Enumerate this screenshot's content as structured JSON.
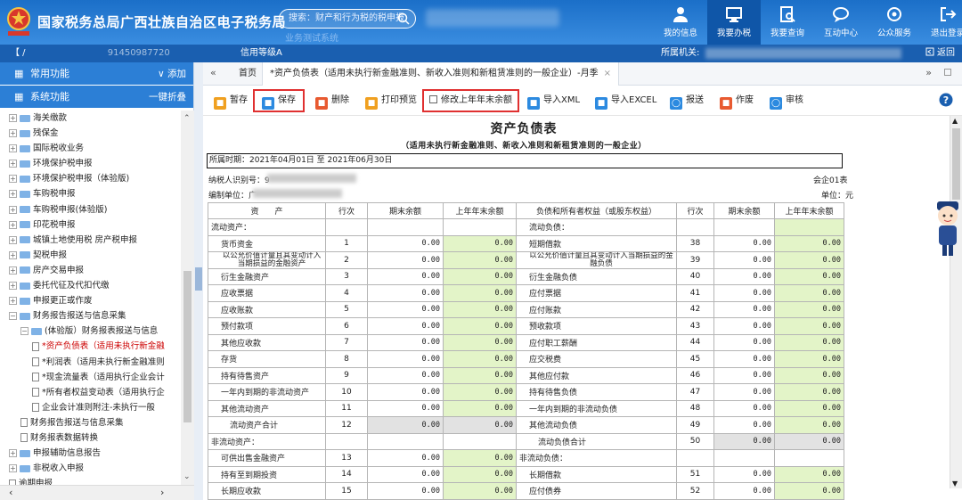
{
  "header": {
    "title": "国家税务总局广西壮族自治区电子税务局",
    "search_placeholder": "搜索：财产和行为税的税申报",
    "banner_sub": "业务测试系统",
    "nav": [
      {
        "label": "我的信息",
        "icon": "user-icon"
      },
      {
        "label": "我要办税",
        "icon": "monitor-icon",
        "active": true
      },
      {
        "label": "我要查询",
        "icon": "query-icon"
      },
      {
        "label": "互动中心",
        "icon": "chat-icon"
      },
      {
        "label": "公众服务",
        "icon": "service-icon"
      },
      {
        "label": "退出登录",
        "icon": "logout-icon"
      }
    ]
  },
  "infobar": {
    "user": "【 / ",
    "user_code": "91450987720",
    "credit": "信用等级A",
    "authority_label": "所属机关:",
    "return_label": "返回"
  },
  "sidebar": {
    "common_label": "常用功能",
    "common_action": "添加",
    "system_label": "系统功能",
    "system_action": "一键折叠",
    "tree": [
      {
        "label": "海关缴款",
        "type": "folder",
        "level": 1
      },
      {
        "label": "残保金",
        "type": "folder",
        "level": 1
      },
      {
        "label": "国际税收业务",
        "type": "folder",
        "level": 1
      },
      {
        "label": "环境保护税申报",
        "type": "folder",
        "level": 1
      },
      {
        "label": "环境保护税申报（体验版)",
        "type": "folder",
        "level": 1
      },
      {
        "label": "车购税申报",
        "type": "folder",
        "level": 1
      },
      {
        "label": "车购税申报(体验版)",
        "type": "folder",
        "level": 1
      },
      {
        "label": "印花税申报",
        "type": "folder",
        "level": 1
      },
      {
        "label": "城镇土地使用税 房产税申报",
        "type": "folder",
        "level": 1
      },
      {
        "label": "契税申报",
        "type": "folder",
        "level": 1
      },
      {
        "label": "房产交易申报",
        "type": "folder",
        "level": 1
      },
      {
        "label": "委托代征及代扣代缴",
        "type": "folder",
        "level": 1
      },
      {
        "label": "申报更正或作废",
        "type": "folder",
        "level": 1
      },
      {
        "label": "财务报告报送与信息采集",
        "type": "folder-open",
        "level": 1
      },
      {
        "label": "(体验版）财务报表报送与信息",
        "type": "folder-open",
        "level": 2
      },
      {
        "label": "*资产负债表（适用未执行新金融",
        "type": "doc",
        "level": 3,
        "selected": true
      },
      {
        "label": "*利润表（适用未执行新金融准则",
        "type": "doc",
        "level": 3
      },
      {
        "label": "*现金流量表（适用执行企业会计",
        "type": "doc",
        "level": 3
      },
      {
        "label": "*所有者权益变动表（适用执行企",
        "type": "doc",
        "level": 3
      },
      {
        "label": "企业会计准则附注-未执行一般",
        "type": "doc",
        "level": 3
      },
      {
        "label": "财务报告报送与信息采集",
        "type": "doc",
        "level": 2
      },
      {
        "label": "财务报表数据转换",
        "type": "doc",
        "level": 2
      },
      {
        "label": "申报辅助信息报告",
        "type": "folder",
        "level": 1
      },
      {
        "label": "非税收入申报",
        "type": "folder",
        "level": 1
      },
      {
        "label": "逾期申报",
        "type": "doc",
        "level": 1
      }
    ]
  },
  "tabs": {
    "home": "首页",
    "active": "*资产负债表（适用未执行新金融准则、新收入准则和新租赁准则的一般企业）-月季"
  },
  "toolbar": {
    "buttons": [
      {
        "label": "暂存",
        "color": "#f0a020"
      },
      {
        "label": "保存",
        "color": "#2c8ae0"
      },
      {
        "label": "删除",
        "color": "#e85a30"
      },
      {
        "label": "打印预览",
        "color": "#f0a020"
      },
      {
        "label": "修改上年年末余额",
        "checkbox": true
      },
      {
        "label": "导入XML",
        "color": "#2c8ae0"
      },
      {
        "label": "导入EXCEL",
        "color": "#2c8ae0"
      },
      {
        "label": "报送",
        "color": "#2c8ae0"
      },
      {
        "label": "作废",
        "color": "#e85a30"
      },
      {
        "label": "审核",
        "color": "#2c8ae0"
      }
    ]
  },
  "report": {
    "title": "资产负债表",
    "subtitle": "（适用未执行新金融准则、新收入准则和新租赁准则的一般企业）",
    "period": "所属时期：2021年04月01日 至 2021年06月30日",
    "taxid_label": "纳税人识别号：9",
    "form_code": "会企01表",
    "unit_label": "编制单位：广",
    "currency": "单位：元",
    "headers": [
      "资　　产",
      "行次",
      "期末余额",
      "上年年末余额",
      "负债和所有者权益（或股东权益）",
      "行次",
      "期末余额",
      "上年年末余额"
    ],
    "rows": [
      {
        "a": "流动资产：",
        "an": "",
        "av": "",
        "ap": "",
        "l": "流动负债：",
        "ln": "",
        "lv": "",
        "lp": "",
        "section": true
      },
      {
        "a": "货币资金",
        "an": "1",
        "av": "0.00",
        "ap": "0.00",
        "l": "短期借款",
        "ln": "38",
        "lv": "0.00",
        "lp": "0.00"
      },
      {
        "a": "以公允价值计量且其变动计入当期损益的金融资产",
        "an": "2",
        "av": "0.00",
        "ap": "0.00",
        "l": "以公允价值计量且其变动计入当期损益的金融负债",
        "ln": "39",
        "lv": "0.00",
        "lp": "0.00",
        "two": true
      },
      {
        "a": "衍生金融资产",
        "an": "3",
        "av": "0.00",
        "ap": "0.00",
        "l": "衍生金融负债",
        "ln": "40",
        "lv": "0.00",
        "lp": "0.00"
      },
      {
        "a": "应收票据",
        "an": "4",
        "av": "0.00",
        "ap": "0.00",
        "l": "应付票据",
        "ln": "41",
        "lv": "0.00",
        "lp": "0.00"
      },
      {
        "a": "应收账款",
        "an": "5",
        "av": "0.00",
        "ap": "0.00",
        "l": "应付账款",
        "ln": "42",
        "lv": "0.00",
        "lp": "0.00"
      },
      {
        "a": "预付款项",
        "an": "6",
        "av": "0.00",
        "ap": "0.00",
        "l": "预收款项",
        "ln": "43",
        "lv": "0.00",
        "lp": "0.00"
      },
      {
        "a": "其他应收款",
        "an": "7",
        "av": "0.00",
        "ap": "0.00",
        "l": "应付职工薪酬",
        "ln": "44",
        "lv": "0.00",
        "lp": "0.00"
      },
      {
        "a": "存货",
        "an": "8",
        "av": "0.00",
        "ap": "0.00",
        "l": "应交税费",
        "ln": "45",
        "lv": "0.00",
        "lp": "0.00"
      },
      {
        "a": "持有待售资产",
        "an": "9",
        "av": "0.00",
        "ap": "0.00",
        "l": "其他应付款",
        "ln": "46",
        "lv": "0.00",
        "lp": "0.00"
      },
      {
        "a": "一年内到期的非流动资产",
        "an": "10",
        "av": "0.00",
        "ap": "0.00",
        "l": "持有待售负债",
        "ln": "47",
        "lv": "0.00",
        "lp": "0.00"
      },
      {
        "a": "其他流动资产",
        "an": "11",
        "av": "0.00",
        "ap": "0.00",
        "l": "一年内到期的非流动负债",
        "ln": "48",
        "lv": "0.00",
        "lp": "0.00"
      },
      {
        "a": "流动资产合计",
        "an": "12",
        "av": "0.00",
        "ap": "0.00",
        "l": "其他流动负债",
        "ln": "49",
        "lv": "0.00",
        "lp": "0.00",
        "atotal": true
      },
      {
        "a": "非流动资产：",
        "an": "",
        "av": "",
        "ap": "",
        "l": "流动负债合计",
        "ln": "50",
        "lv": "0.00",
        "lp": "0.00",
        "section": true,
        "ltotal": true
      },
      {
        "a": "可供出售金融资产",
        "an": "13",
        "av": "0.00",
        "ap": "0.00",
        "l": "非流动负债：",
        "ln": "",
        "lv": "",
        "lp": "",
        "lsection": true
      },
      {
        "a": "持有至到期投资",
        "an": "14",
        "av": "0.00",
        "ap": "0.00",
        "l": "长期借款",
        "ln": "51",
        "lv": "0.00",
        "lp": "0.00"
      },
      {
        "a": "长期应收款",
        "an": "15",
        "av": "0.00",
        "ap": "0.00",
        "l": "应付债券",
        "ln": "52",
        "lv": "0.00",
        "lp": "0.00"
      }
    ]
  }
}
